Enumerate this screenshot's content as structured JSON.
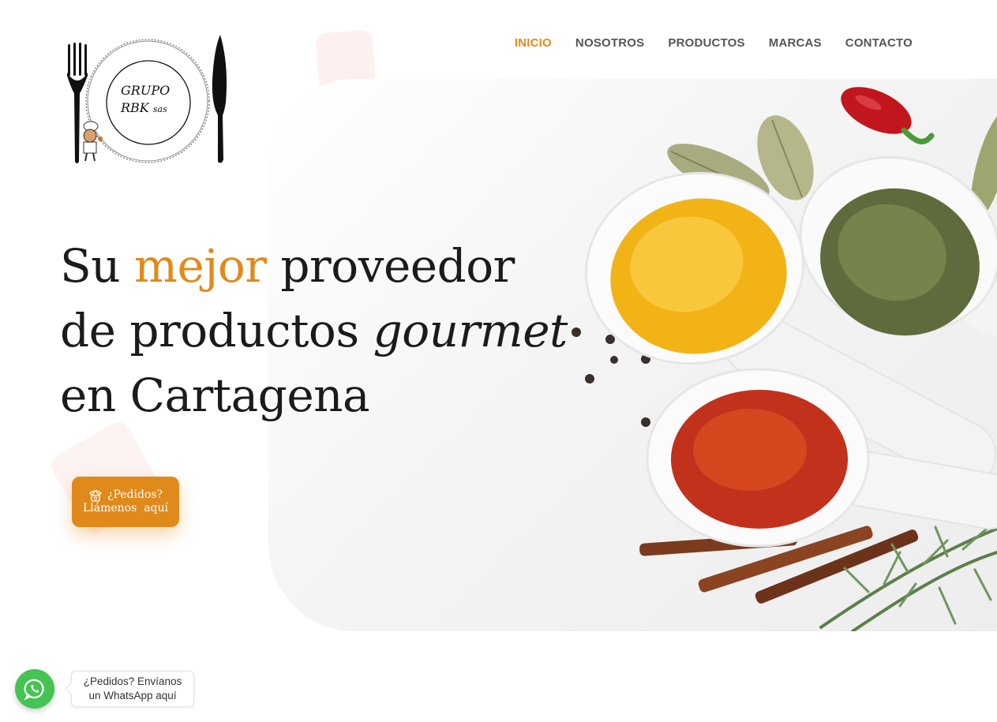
{
  "logo": {
    "line1": "GRUPO",
    "line2": "RBK",
    "suffix": "sas"
  },
  "nav": {
    "items": [
      {
        "label": "INICIO",
        "active": true
      },
      {
        "label": "NOSOTROS",
        "active": false
      },
      {
        "label": "PRODUCTOS",
        "active": false
      },
      {
        "label": "MARCAS",
        "active": false
      },
      {
        "label": "CONTACTO",
        "active": false
      }
    ]
  },
  "hero": {
    "word1": "Su",
    "accent": "mejor",
    "word3": "proveedor",
    "line2_prefix": "de productos",
    "line2_italic": "gourmet",
    "line3": "en Cartagena",
    "image_icon": "spices-image"
  },
  "cta": {
    "icon": "phone-icon",
    "line1": "¿Pedidos?",
    "line2": "Llámenos  aquí"
  },
  "whatsapp": {
    "icon": "whatsapp-icon",
    "line1": "¿Pedidos? Envíanos",
    "line2": "un WhatsApp aquí"
  },
  "colors": {
    "accent": "#e08a1c",
    "nav_text": "#555555",
    "whatsapp": "#46c453",
    "headline": "#1b1b1b"
  }
}
